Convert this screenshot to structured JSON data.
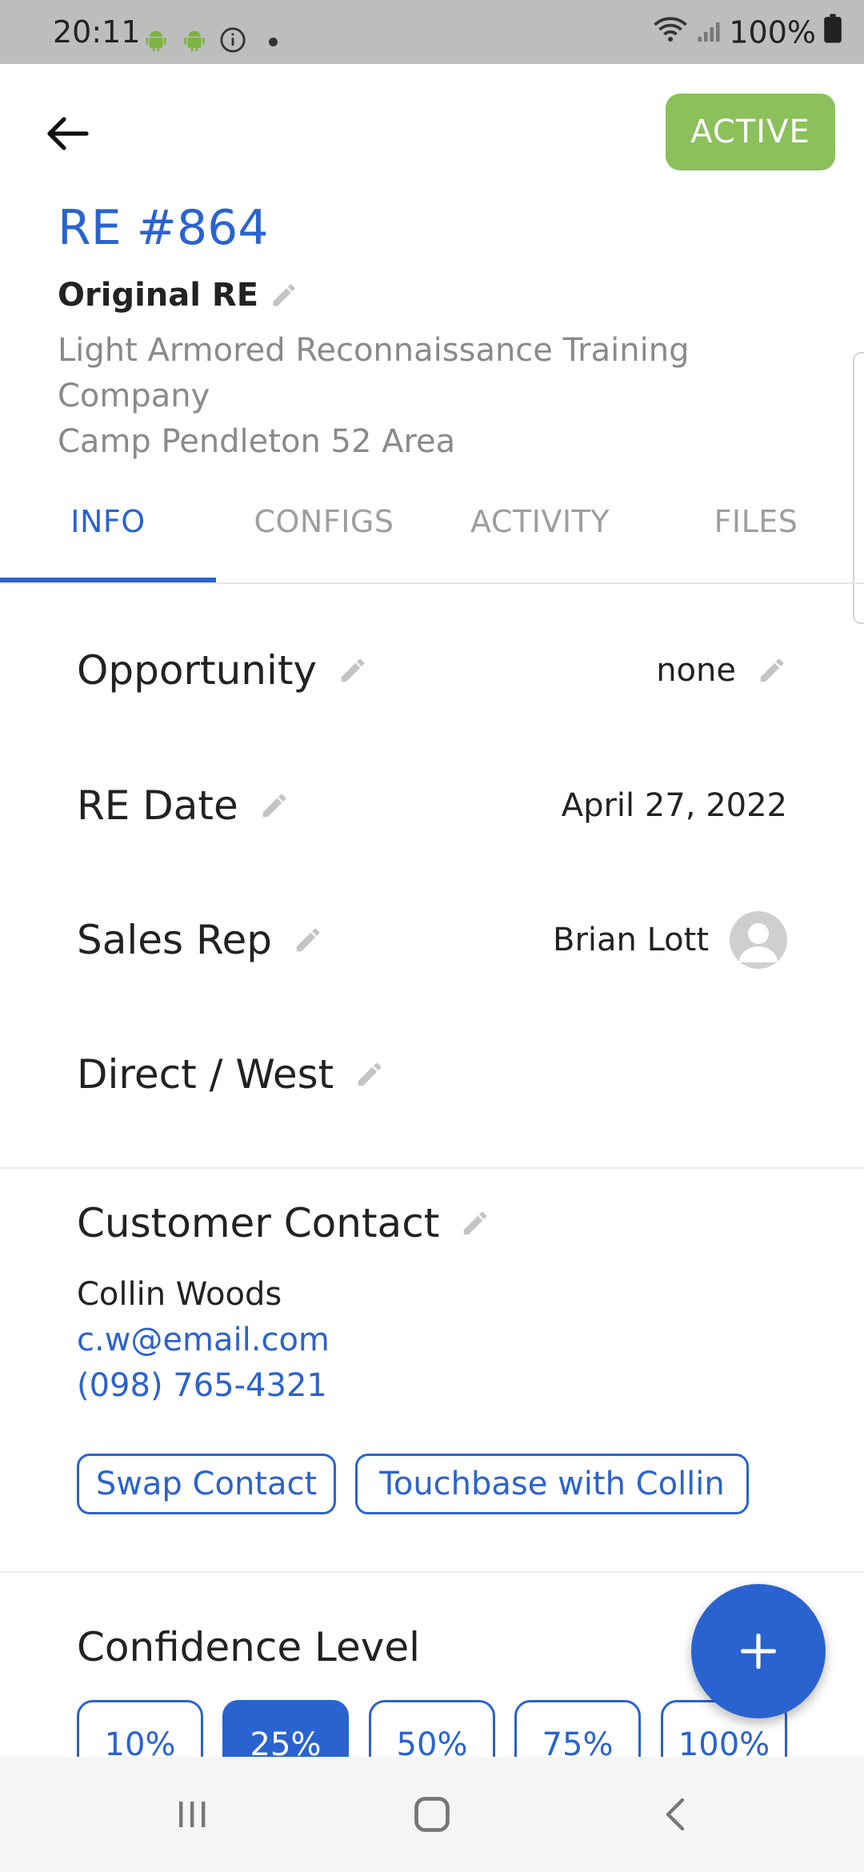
{
  "status_bar": {
    "time": "20:11",
    "battery": "100%",
    "icons": [
      "android-icon",
      "android-icon",
      "info-icon",
      "dot-icon",
      "wifi-icon",
      "signal-icon",
      "battery-icon"
    ]
  },
  "header": {
    "status_label": "ACTIVE",
    "re_number": "RE #864",
    "re_kind": "Original RE",
    "company_line1": "Light Armored Reconnaissance Training",
    "company_line2": "Company",
    "location": "Camp Pendleton 52 Area"
  },
  "tabs": [
    {
      "label": "INFO",
      "active": true
    },
    {
      "label": "CONFIGS",
      "active": false
    },
    {
      "label": "ACTIVITY",
      "active": false
    },
    {
      "label": "FILES",
      "active": false
    }
  ],
  "info": {
    "opportunity": {
      "label": "Opportunity",
      "value": "none"
    },
    "re_date": {
      "label": "RE Date",
      "value": "April 27, 2022"
    },
    "sales_rep": {
      "label": "Sales Rep",
      "value": "Brian Lott"
    },
    "channel": {
      "label": "Direct / West"
    }
  },
  "contact": {
    "title": "Customer Contact",
    "name": "Collin Woods",
    "email": "c.w@email.com",
    "phone": "(098) 765-4321",
    "swap_label": "Swap Contact",
    "touchbase_label": "Touchbase with Collin"
  },
  "confidence": {
    "title": "Confidence Level",
    "options": [
      "10%",
      "25%",
      "50%",
      "75%",
      "100%"
    ],
    "selected": "25%"
  },
  "fab": {
    "icon": "plus-icon"
  },
  "colors": {
    "accent": "#2a63cf",
    "active_chip": "#8bc05a",
    "status_bar": "#bdbdbd"
  }
}
